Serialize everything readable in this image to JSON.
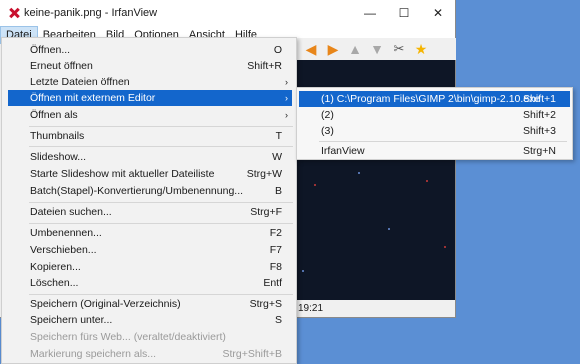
{
  "window": {
    "title": "keine-panik.png - IrfanView",
    "controls": {
      "minimize": "—",
      "maximize": "☐",
      "close": "✕"
    }
  },
  "menubar": [
    "Datei",
    "Bearbeiten",
    "Bild",
    "Optionen",
    "Ansicht",
    "Hilfe"
  ],
  "toolbar": {
    "back": "◀",
    "forward": "▶",
    "up": "▲",
    "down": "▼",
    "tools": "✂",
    "star": "★"
  },
  "statusbar": {
    "time": "19:21"
  },
  "dropdown": {
    "items": [
      {
        "label": "Öffnen...",
        "shortcut": "O"
      },
      {
        "label": "Erneut öffnen",
        "shortcut": "Shift+R"
      },
      {
        "label": "Letzte Dateien öffnen",
        "shortcut": ""
      },
      {
        "label": "Öffnen mit externem Editor",
        "shortcut": ""
      },
      {
        "label": "Öffnen als",
        "shortcut": ""
      },
      {
        "label": "Thumbnails",
        "shortcut": "T"
      },
      {
        "label": "Slideshow...",
        "shortcut": "W"
      },
      {
        "label": "Starte Slideshow mit aktueller Dateiliste",
        "shortcut": "Strg+W"
      },
      {
        "label": "Batch(Stapel)-Konvertierung/Umbenennung...",
        "shortcut": "B"
      },
      {
        "label": "Dateien suchen...",
        "shortcut": "Strg+F"
      },
      {
        "label": "Umbenennen...",
        "shortcut": "F2"
      },
      {
        "label": "Verschieben...",
        "shortcut": "F7"
      },
      {
        "label": "Kopieren...",
        "shortcut": "F8"
      },
      {
        "label": "Löschen...",
        "shortcut": "Entf"
      },
      {
        "label": "Speichern (Original-Verzeichnis)",
        "shortcut": "Strg+S"
      },
      {
        "label": "Speichern unter...",
        "shortcut": "S"
      },
      {
        "label": "Speichern fürs Web... (veraltet/deaktiviert)",
        "shortcut": ""
      },
      {
        "label": "Markierung speichern als...",
        "shortcut": "Strg+Shift+B"
      }
    ],
    "submenu_arrow": "›"
  },
  "submenu": {
    "items": [
      {
        "label": "(1) C:\\Program Files\\GIMP 2\\bin\\gimp-2.10.exe",
        "shortcut": "Shift+1"
      },
      {
        "label": "(2)",
        "shortcut": "Shift+2"
      },
      {
        "label": "(3)",
        "shortcut": "Shift+3"
      },
      {
        "label": "IrfanView",
        "shortcut": "Strg+N"
      }
    ]
  }
}
